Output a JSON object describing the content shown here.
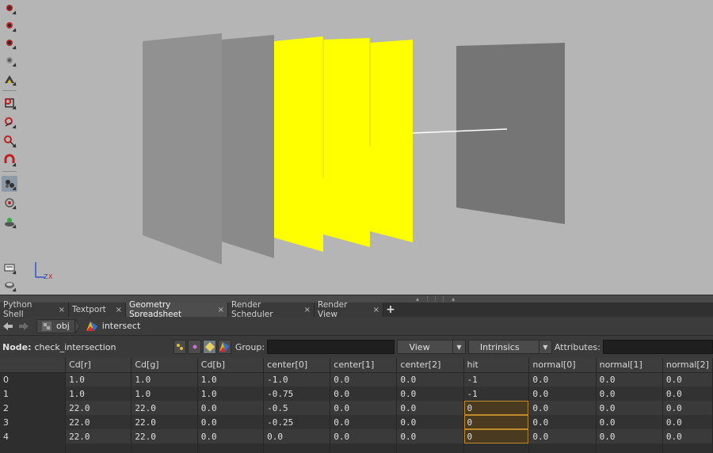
{
  "axis": {
    "x": "X",
    "z": "Z"
  },
  "tabs": [
    {
      "label": "Python Shell",
      "closable": true
    },
    {
      "label": "Textport",
      "closable": true
    },
    {
      "label": "Geometry Spreadsheet",
      "closable": true,
      "active": true
    },
    {
      "label": "Render Scheduler",
      "closable": true
    },
    {
      "label": "Render View",
      "closable": true
    }
  ],
  "tab_close_glyph": "×",
  "tab_add_glyph": "+",
  "path": {
    "back_icon": "arrow-left-icon",
    "forward_icon": "arrow-right-icon",
    "root": "obj",
    "node": "intersect"
  },
  "node_row": {
    "label": "Node:",
    "node_name": "check_intersection",
    "group_label": "Group:",
    "group_value": "",
    "view_label": "View",
    "intrinsics_label": "Intrinsics",
    "attributes_label": "Attributes:",
    "attributes_value": ""
  },
  "spreadsheet": {
    "columns": [
      "",
      "Cd[r]",
      "Cd[g]",
      "Cd[b]",
      "center[0]",
      "center[1]",
      "center[2]",
      "hit",
      "normal[0]",
      "normal[1]",
      "normal[2]"
    ],
    "rows": [
      [
        "0",
        "1.0",
        "1.0",
        "1.0",
        "-1.0",
        "0.0",
        "0.0",
        "-1",
        "0.0",
        "0.0",
        "0.0"
      ],
      [
        "1",
        "1.0",
        "1.0",
        "1.0",
        "-0.75",
        "0.0",
        "0.0",
        "-1",
        "0.0",
        "0.0",
        "0.0"
      ],
      [
        "2",
        "22.0",
        "22.0",
        "0.0",
        "-0.5",
        "0.0",
        "0.0",
        "0",
        "0.0",
        "0.0",
        "0.0"
      ],
      [
        "3",
        "22.0",
        "22.0",
        "0.0",
        "-0.25",
        "0.0",
        "0.0",
        "0",
        "0.0",
        "0.0",
        "0.0"
      ],
      [
        "4",
        "22.0",
        "22.0",
        "0.0",
        "0.0",
        "0.0",
        "0.0",
        "0",
        "0.0",
        "0.0",
        "0.0"
      ]
    ],
    "highlight_column": "hit",
    "highlight_rows": [
      2,
      3,
      4
    ]
  },
  "colors": {
    "viewport_bg": "#b5b5b5",
    "plane_grey": "#8e8e8e",
    "plane_grey_dark": "#7a7a7a",
    "plane_yellow": "#ffff00",
    "ray": "#ffffff",
    "highlight_border": "#c08a2a"
  }
}
